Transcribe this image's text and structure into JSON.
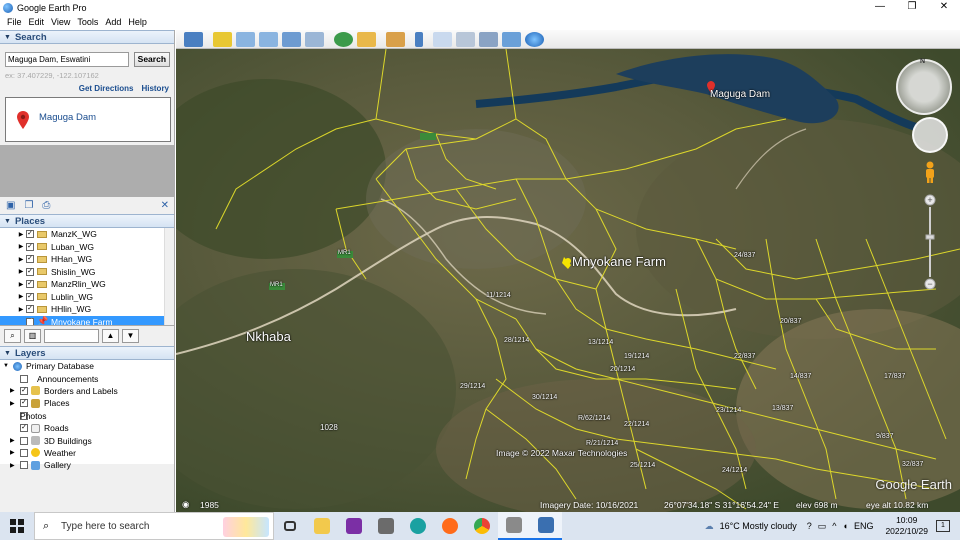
{
  "window": {
    "title": "Google Earth Pro",
    "controls": [
      "—",
      "❐",
      "✕"
    ]
  },
  "menu": [
    "File",
    "Edit",
    "View",
    "Tools",
    "Add",
    "Help"
  ],
  "search": {
    "header": "Search",
    "query": "Maguga Dam, Eswatini",
    "button": "Search",
    "coords": "ex: 37.407229, -122.107162",
    "get_directions": "Get Directions",
    "history": "History",
    "result": "Maguga Dam"
  },
  "places": {
    "header": "Places",
    "items": [
      {
        "label": "ManzK_WG",
        "checked": true,
        "selected": false
      },
      {
        "label": "Luban_WG",
        "checked": true,
        "selected": false
      },
      {
        "label": "HHan_WG",
        "checked": true,
        "selected": false
      },
      {
        "label": "Shislin_WG",
        "checked": true,
        "selected": false
      },
      {
        "label": "ManzRlin_WG",
        "checked": true,
        "selected": false
      },
      {
        "label": "Lublin_WG",
        "checked": true,
        "selected": false
      },
      {
        "label": "HHlin_WG",
        "checked": true,
        "selected": false
      },
      {
        "label": "Mnyokane Farm",
        "checked": true,
        "selected": true
      }
    ]
  },
  "layers": {
    "header": "Layers",
    "items": [
      {
        "label": "Primary Database",
        "icon": "globe-icon",
        "indent": 0,
        "checked": null
      },
      {
        "label": "Announcements",
        "icon": "none",
        "indent": 1,
        "checked": false
      },
      {
        "label": "Borders and Labels",
        "icon": "border-icon",
        "indent": 1,
        "checked": true
      },
      {
        "label": "Places",
        "icon": "places-icon",
        "indent": 1,
        "checked": true
      },
      {
        "label": "Photos",
        "icon": "none",
        "indent": 1,
        "checked": false
      },
      {
        "label": "Roads",
        "icon": "roads-icon",
        "indent": 1,
        "checked": true
      },
      {
        "label": "3D Buildings",
        "icon": "buildings-icon",
        "indent": 1,
        "checked": null
      },
      {
        "label": "Weather",
        "icon": "weather-icon",
        "indent": 1,
        "checked": null
      },
      {
        "label": "Gallery",
        "icon": "gallery-icon",
        "indent": 1,
        "checked": null
      }
    ]
  },
  "map": {
    "labels": {
      "maguga_dam": "Maguga Dam",
      "mnyokane_farm": "Mnyokane Farm",
      "nkhaba": "Nkhaba",
      "road_mr1_a": "MR1",
      "road_mr1_b": "MR1",
      "field_1028": "1028",
      "field_2912": "29/1214",
      "field_3012": "30/1214",
      "field_2412": "24/1214",
      "field_2312": "23/1214",
      "field_1483": "14/837",
      "field_2283": "22/837",
      "field_1383": "13/837",
      "field_2083": "20/837",
      "field_1783": "17/837",
      "field_983": "9/837",
      "field_3283": "32/837",
      "field_2512": "25/1214",
      "field_1912": "19/1214",
      "field_2012": "20/1214",
      "field_2812": "28/1214",
      "field_1312": "13/1214",
      "field_1112": "11/1214",
      "field_r6212": "R/62/1214",
      "field_r2112": "R/21/1214",
      "field_2212": "22/1214",
      "field_2737": "24/837"
    },
    "copyright": "Image © 2022 Maxar Technologies",
    "brand": "Google Earth",
    "year": "1985",
    "imagery_date": "Imagery Date: 10/16/2021",
    "coords": "26°07'34.18\" S    31°16'54.24\" E",
    "elev": "elev   698 m",
    "eye_alt": "eye alt   10.82 km"
  },
  "taskbar": {
    "search_placeholder": "Type here to search",
    "weather": "16°C  Mostly cloudy",
    "lang": "ENG",
    "time": "10:09",
    "date": "2022/10/29",
    "notifications": "1"
  }
}
